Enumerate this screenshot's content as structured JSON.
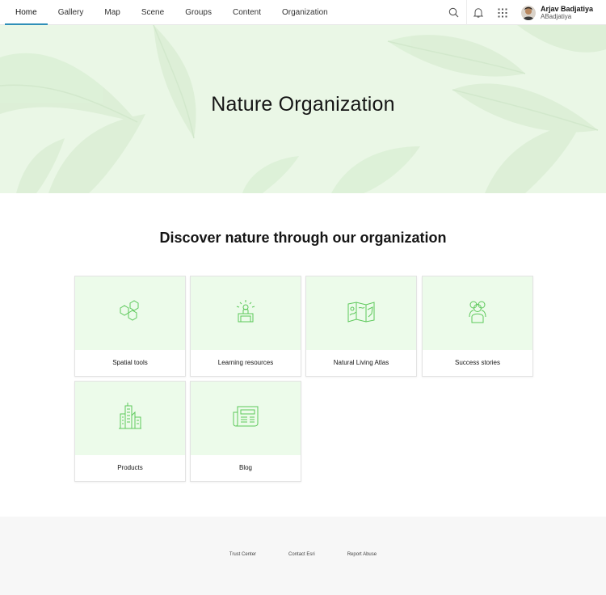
{
  "nav": {
    "links": [
      "Home",
      "Gallery",
      "Map",
      "Scene",
      "Groups",
      "Content",
      "Organization"
    ],
    "active_index": 0
  },
  "icons": {
    "search": "search-icon",
    "notifications": "bell-icon",
    "apps": "app-launcher-icon"
  },
  "user": {
    "name": "Arjav Badjatiya",
    "login": "ABadjatiya"
  },
  "hero": {
    "title": "Nature Organization"
  },
  "section": {
    "title": "Discover nature through our organization"
  },
  "cards": [
    {
      "label": "Spatial tools",
      "icon": "hexagons-icon"
    },
    {
      "label": "Learning resources",
      "icon": "presentation-icon"
    },
    {
      "label": "Natural Living Atlas",
      "icon": "atlas-map-icon"
    },
    {
      "label": "Success stories",
      "icon": "people-group-icon"
    },
    {
      "label": "Products",
      "icon": "city-buildings-icon"
    },
    {
      "label": "Blog",
      "icon": "newspaper-icon"
    }
  ],
  "footer": {
    "links": [
      "Trust Center",
      "Contact Esri",
      "Report Abuse"
    ]
  },
  "colors": {
    "accent": "#2f8fb8",
    "hero_bg": "#eaf7e6",
    "card_thumb_bg": "#ecfbea",
    "icon_stroke": "#5cc85a",
    "footer_bg": "#f7f7f7"
  }
}
